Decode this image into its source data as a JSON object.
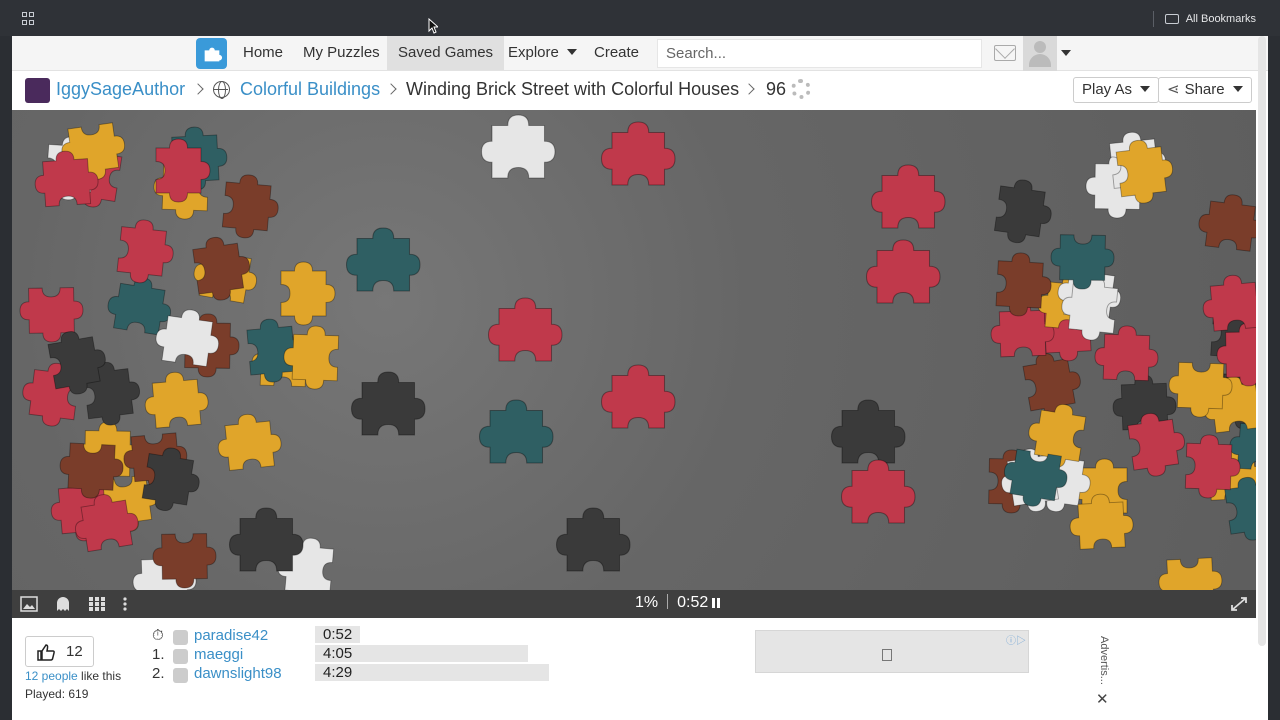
{
  "browser": {
    "bookmarks_label": "All Bookmarks"
  },
  "nav": {
    "items": [
      {
        "label": "Home",
        "active": false
      },
      {
        "label": "My Puzzles",
        "active": false
      },
      {
        "label": "Saved Games",
        "active": true
      },
      {
        "label": "Explore",
        "active": false
      },
      {
        "label": "Create",
        "active": false
      }
    ],
    "search_placeholder": "Search..."
  },
  "breadcrumb": {
    "author": "IggySageAuthor",
    "category": "Colorful Buildings",
    "title": "Winding Brick Street with Colorful Houses",
    "piece_count": "96",
    "play_as_label": "Play As",
    "share_label": "Share"
  },
  "game": {
    "progress_percent": "1%",
    "elapsed_time": "0:52",
    "accent_piece_colors": [
      "#c0394b",
      "#2f5f63",
      "#e0a52a",
      "#e6e6e6",
      "#3a3a3a",
      "#7a3d2a"
    ]
  },
  "footer": {
    "like_count": "12",
    "likes_link": "12 people",
    "likes_suffix": " like this",
    "played_label": "Played: 619",
    "more_label": "•••",
    "ad_label": "Advertis...",
    "ad_tag": "ⓘ▷",
    "close_label": "✕",
    "leaderboard": [
      {
        "rank": "⏱",
        "name": "paradise42",
        "time": "0:52"
      },
      {
        "rank": "1.",
        "name": "maeggi",
        "time": "4:05"
      },
      {
        "rank": "2.",
        "name": "dawnslight98",
        "time": "4:29"
      }
    ]
  }
}
